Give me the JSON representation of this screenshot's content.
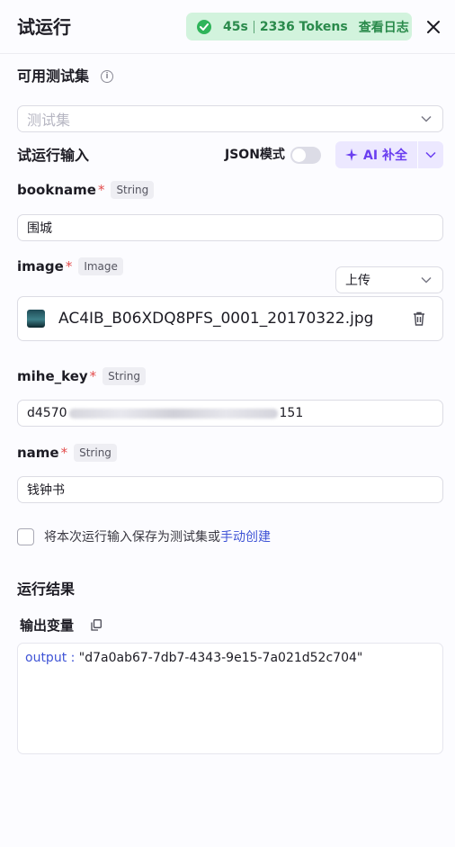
{
  "header": {
    "title": "试运行",
    "status": {
      "duration": "45s",
      "tokens": "2336 Tokens",
      "log_link": "查看日志"
    }
  },
  "testset": {
    "label": "可用测试集",
    "placeholder": "测试集"
  },
  "inputs": {
    "title": "试运行输入",
    "json_mode_label": "JSON模式",
    "json_mode_on": false,
    "ai_button_label": "AI 补全"
  },
  "fields": {
    "bookname": {
      "name": "bookname",
      "type": "String",
      "value": "围城"
    },
    "image": {
      "name": "image",
      "type": "Image",
      "upload_mode": "上传",
      "file_name": "AC4IB_B06XDQ8PFS_0001_20170322.jpg"
    },
    "mihe_key": {
      "name": "mihe_key",
      "type": "String",
      "value_start": "d4570",
      "value_end": "151"
    },
    "name": {
      "name": "name",
      "type": "String",
      "value": "钱钟书"
    }
  },
  "save": {
    "text": "将本次运行输入保存为测试集或",
    "link": "手动创建",
    "checked": false
  },
  "result": {
    "title": "运行结果",
    "output_label": "输出变量",
    "output_key": "output :",
    "output_value": "\"d7a0ab67-7db7-4343-9e15-7a021d52c704\""
  },
  "colors": {
    "accent": "#6a3ef0",
    "link": "#3f54d6",
    "success": "#2fb45a",
    "required": "#e34c4c"
  }
}
